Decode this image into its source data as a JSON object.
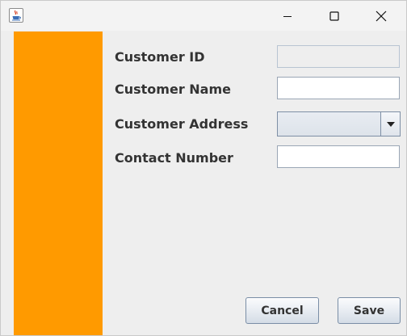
{
  "window": {
    "title_icon": "java-cup-icon",
    "controls": [
      "minimize-icon",
      "maximize-icon",
      "close-icon"
    ]
  },
  "colors": {
    "sidebar": "#ff9a00",
    "background": "#eeeeee"
  },
  "form": {
    "customer_id_label": "Customer ID",
    "customer_name_label": "Customer Name",
    "customer_address_label": "Customer Address",
    "contact_number_label": "Contact Number",
    "customer_id_value": "",
    "customer_name_value": "",
    "customer_address_value": "",
    "contact_number_value": ""
  },
  "buttons": {
    "cancel_label": "Cancel",
    "save_label": "Save"
  }
}
